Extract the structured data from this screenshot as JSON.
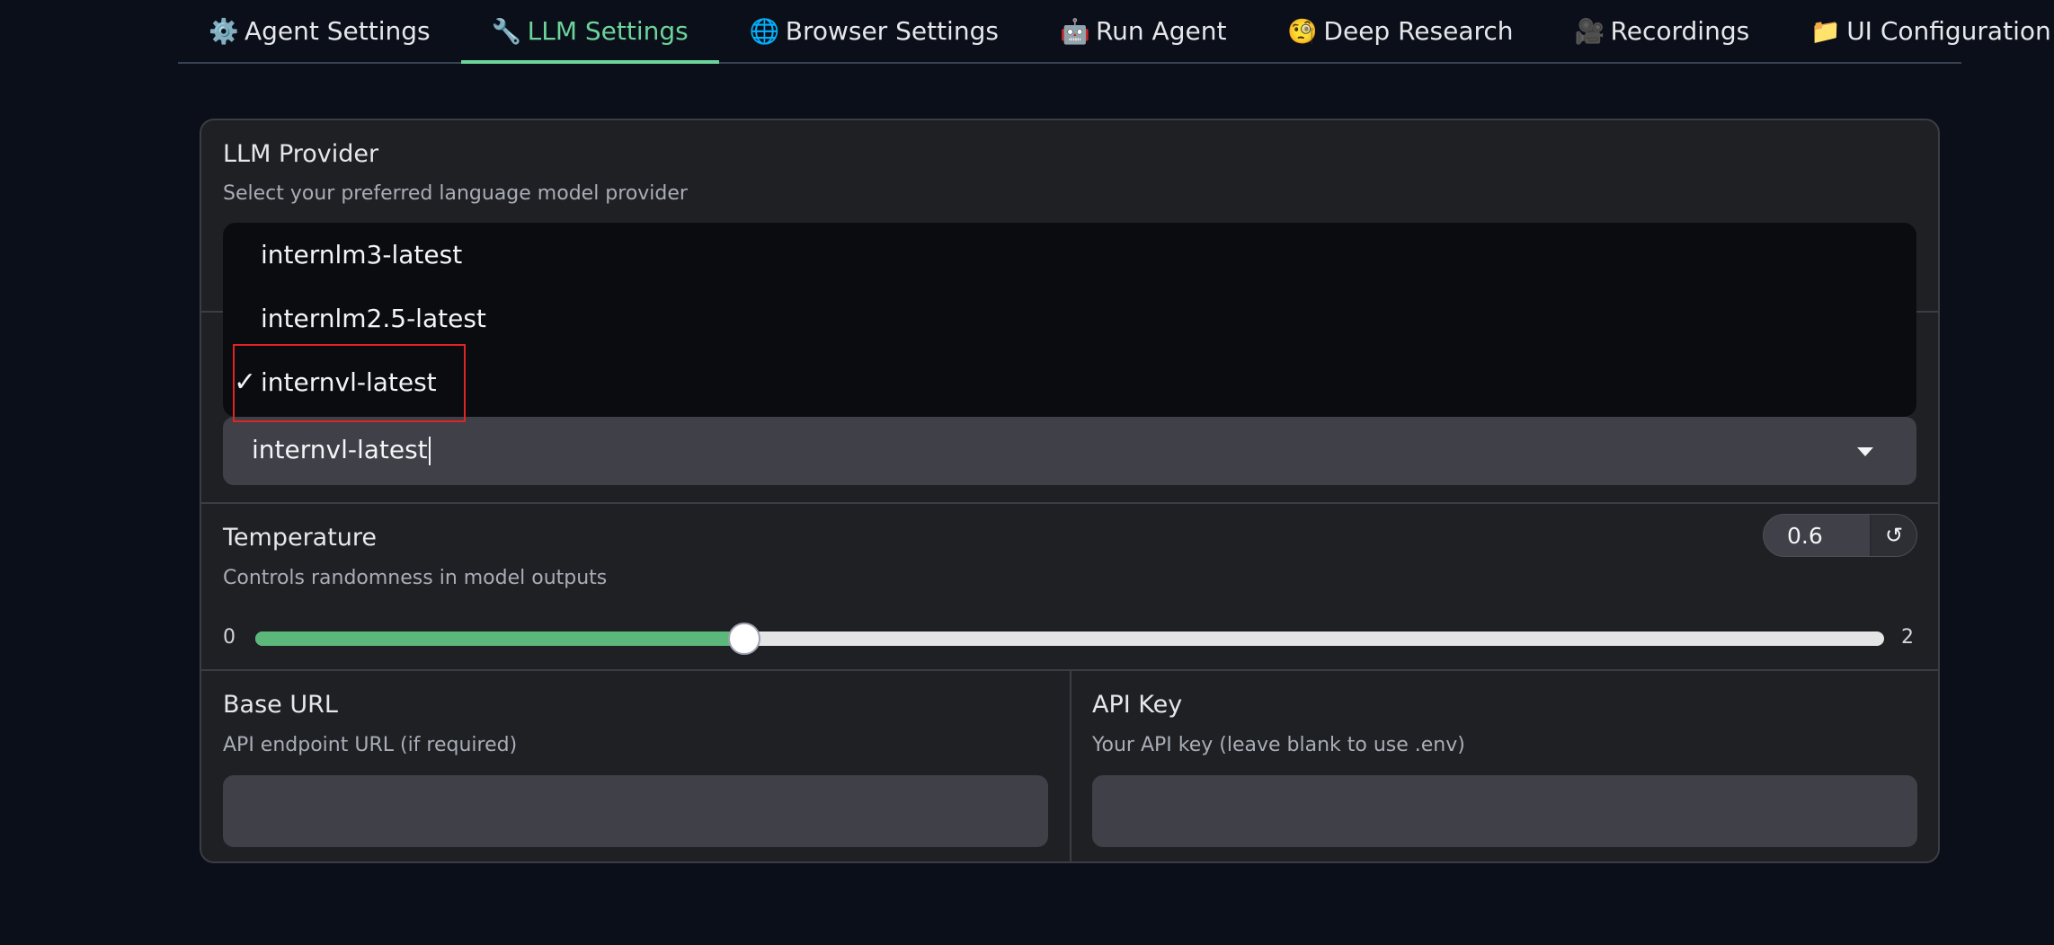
{
  "tabs": [
    {
      "icon": "⚙️",
      "icon_name": "gear-icon",
      "label": "Agent Settings",
      "active": false
    },
    {
      "icon": "🔧",
      "icon_name": "wrench-icon",
      "label": "LLM Settings",
      "active": true
    },
    {
      "icon": "🌐",
      "icon_name": "globe-icon",
      "label": "Browser Settings",
      "active": false
    },
    {
      "icon": "🤖",
      "icon_name": "robot-icon",
      "label": "Run Agent",
      "active": false
    },
    {
      "icon": "🧐",
      "icon_name": "monocle-face-icon",
      "label": "Deep Research",
      "active": false
    },
    {
      "icon": "🎥",
      "icon_name": "movie-camera-icon",
      "label": "Recordings",
      "active": false
    },
    {
      "icon": "📁",
      "icon_name": "folder-icon",
      "label": "UI Configuration",
      "active": false
    }
  ],
  "provider": {
    "label": "LLM Provider",
    "info": "Select your preferred language model provider"
  },
  "model": {
    "dropdown_options": [
      {
        "text": "internlm3-latest",
        "selected": false
      },
      {
        "text": "internlm2.5-latest",
        "selected": false
      },
      {
        "text": "internvl-latest",
        "selected": true
      }
    ],
    "check_mark": "✓",
    "value": "internvl-latest"
  },
  "temperature": {
    "label": "Temperature",
    "info": "Controls randomness in model outputs",
    "value": "0.6",
    "min": "0",
    "max": "2",
    "fraction": 0.3,
    "reset_symbol": "↺"
  },
  "base_url": {
    "label": "Base URL",
    "info": "API endpoint URL (if required)",
    "value": ""
  },
  "api_key": {
    "label": "API Key",
    "info": "Your API key (leave blank to use .env)",
    "value": ""
  },
  "colors": {
    "accent": "#6dd39a",
    "slider_fill": "#5cb77a",
    "highlight": "#e02424",
    "background": "#0b0f19"
  }
}
